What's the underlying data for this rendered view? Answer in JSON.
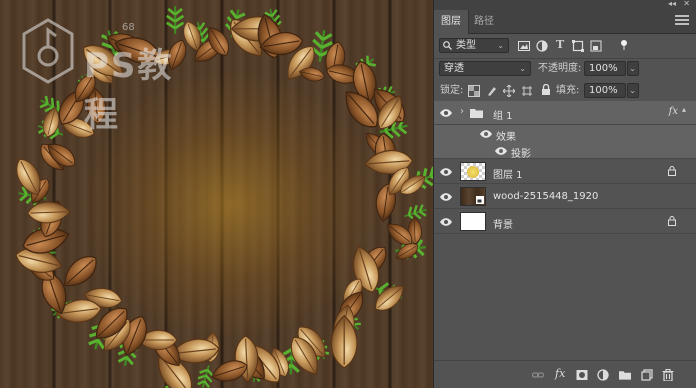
{
  "logo": {
    "small_text": "68",
    "text": "PS教程"
  },
  "panel": {
    "tabs": [
      {
        "label": "图层",
        "active": true
      },
      {
        "label": "路径",
        "active": false
      }
    ],
    "filter": {
      "label": "类型"
    },
    "blend_mode": "穿透",
    "opacity": {
      "label": "不透明度:",
      "value": "100%"
    },
    "lock": {
      "label": "锁定:"
    },
    "fill": {
      "label": "填充:",
      "value": "100%"
    },
    "layers": [
      {
        "name": "组 1",
        "type": "group",
        "fx": "fx",
        "selected": true,
        "locked": false
      },
      {
        "name": "效果",
        "type": "effects-header"
      },
      {
        "name": "投影",
        "type": "effect"
      },
      {
        "name": "图层 1",
        "type": "pixel",
        "locked": true
      },
      {
        "name": "wood-2515448_1920",
        "type": "smart-object",
        "locked": false
      },
      {
        "name": "背景",
        "type": "background",
        "locked": true
      }
    ],
    "bottom_icons": [
      "link-icon",
      "fx-icon",
      "mask-icon",
      "adjustment-icon",
      "folder-icon",
      "new-layer-icon",
      "trash-icon"
    ],
    "fx_label": "fx"
  },
  "colors": {
    "panel": "#535353",
    "selected": "#636363",
    "dark": "#424242",
    "wood": "#4d3825",
    "leaf": "#b8894f",
    "fern": "#4e9a2a"
  }
}
